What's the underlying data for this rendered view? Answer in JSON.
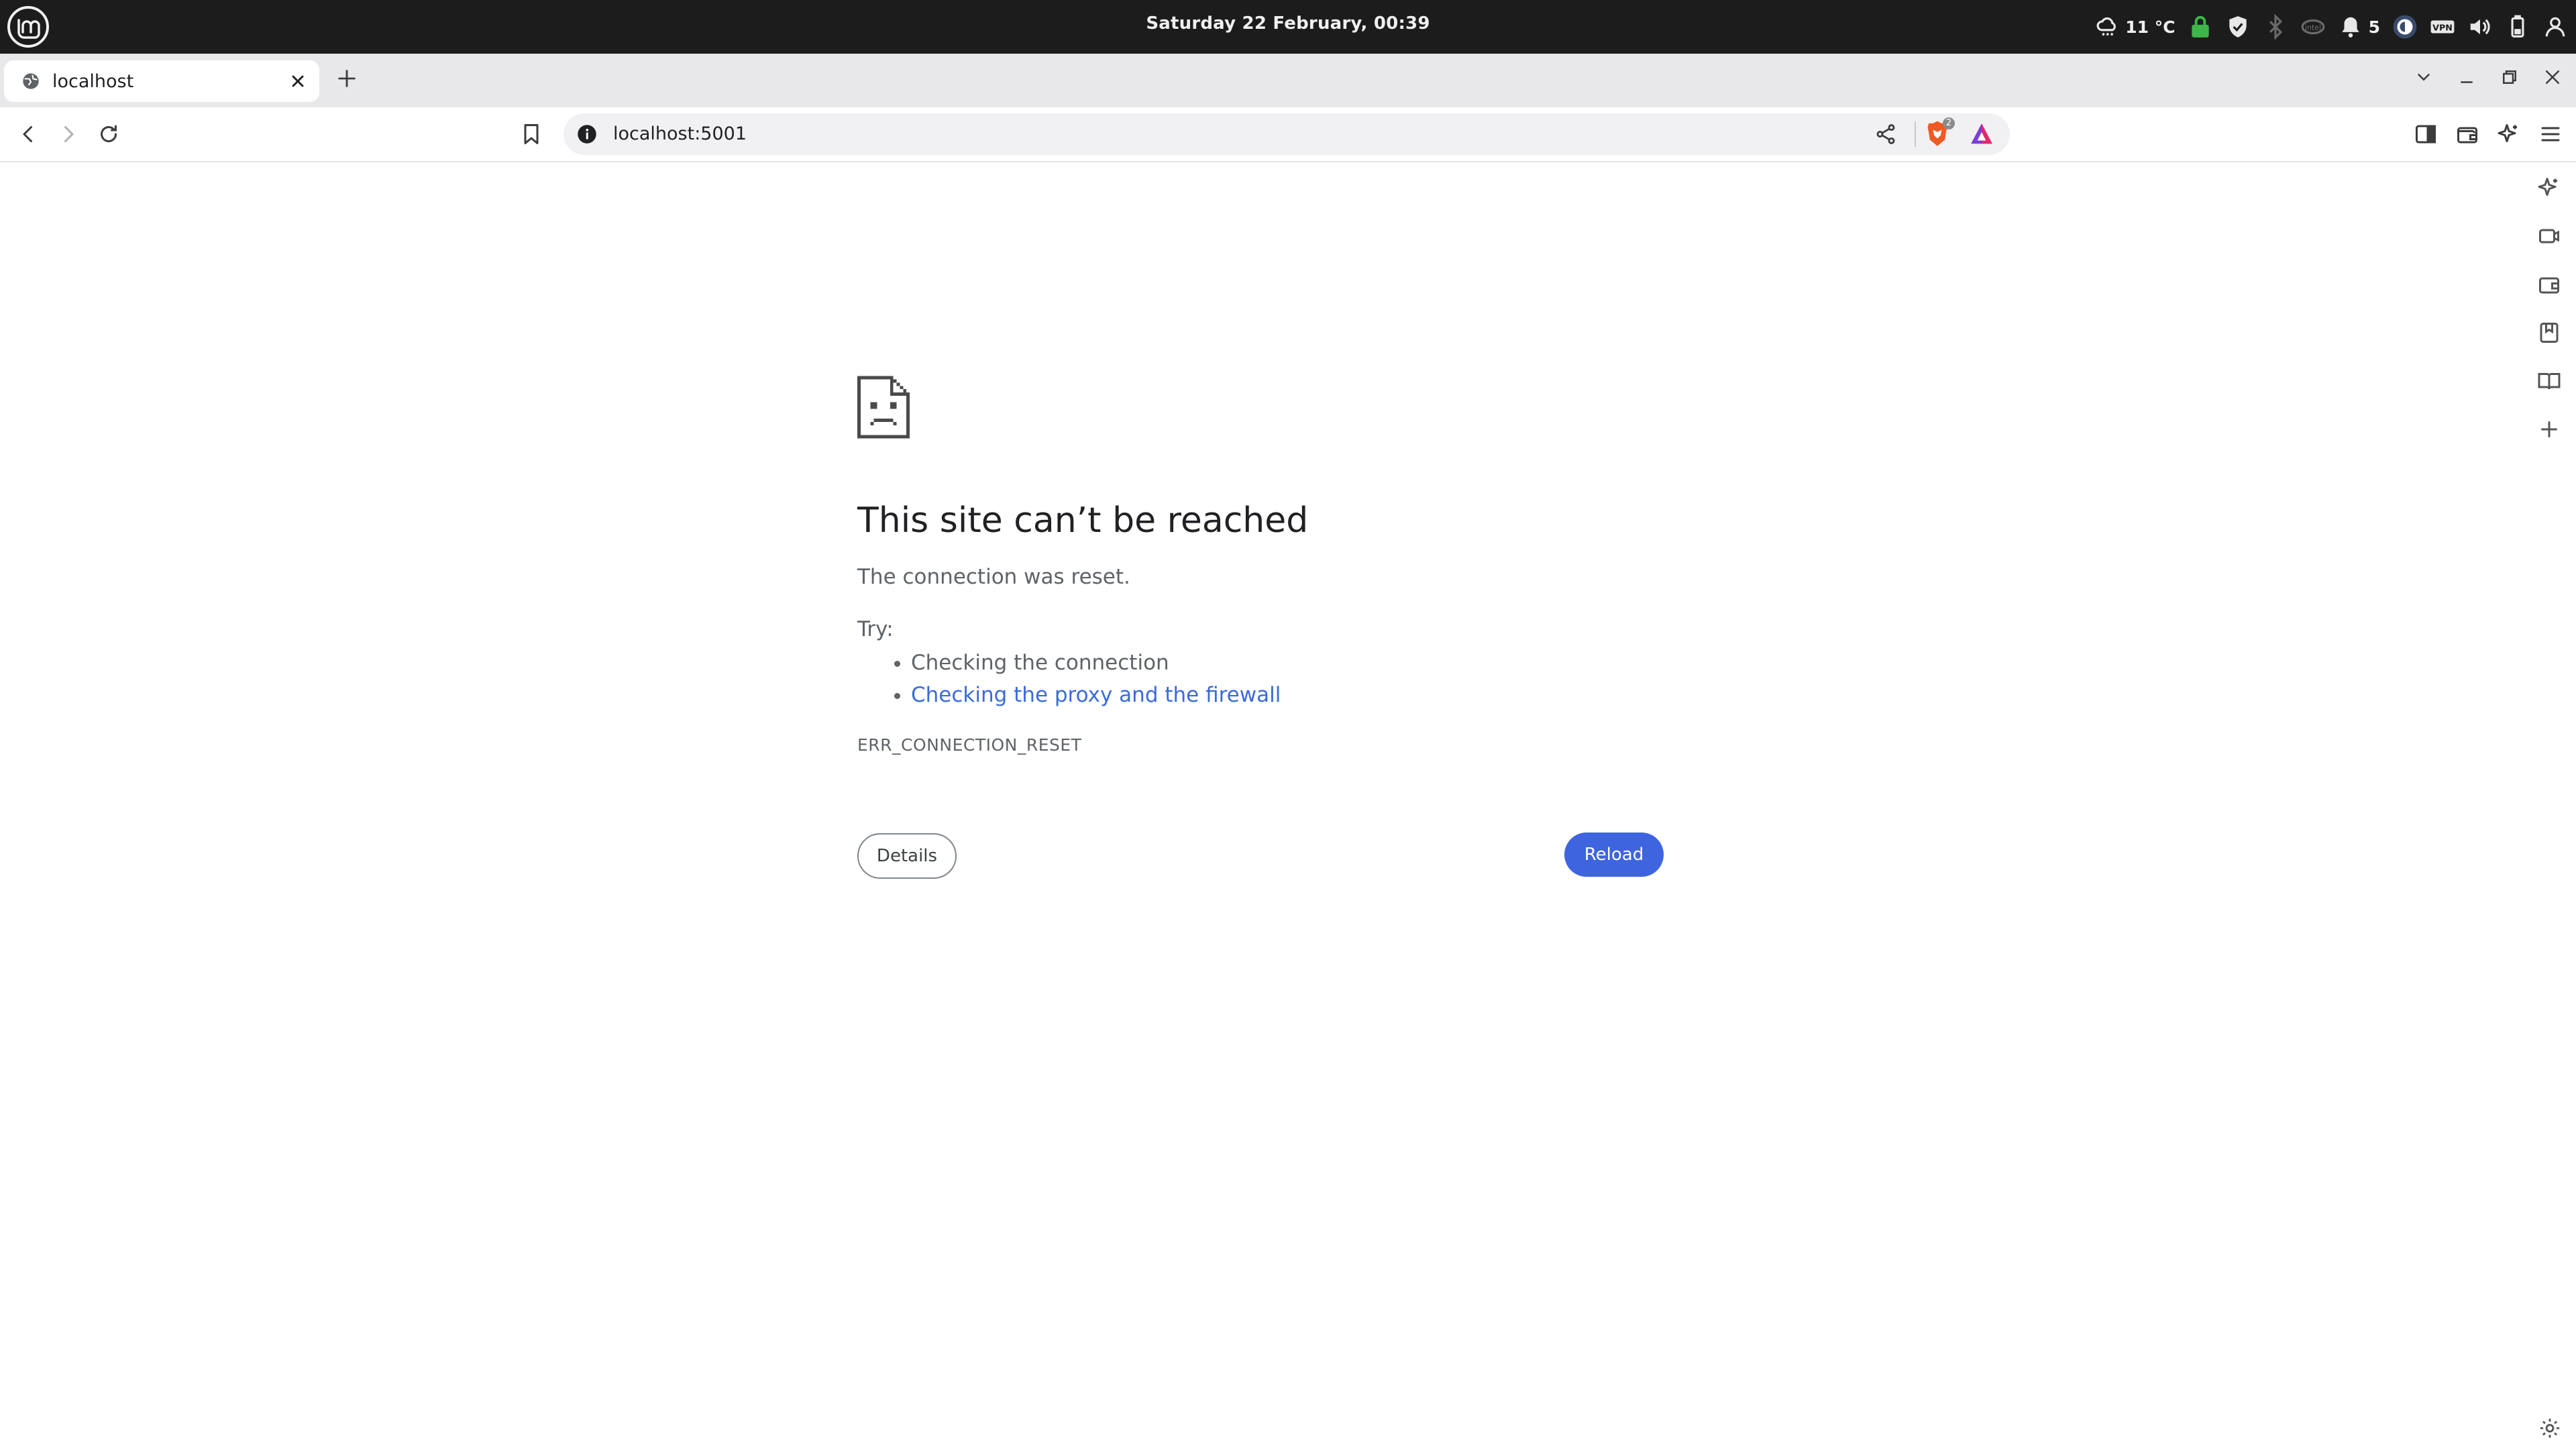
{
  "os_panel": {
    "clock": "Saturday 22 February, 00:39",
    "weather": "11 °C",
    "notification_count": "5"
  },
  "browser": {
    "tab": {
      "title": "localhost"
    },
    "address_bar": {
      "url": "localhost:5001"
    },
    "shields_count": "2"
  },
  "error_page": {
    "title": "This site can’t be reached",
    "summary": "The connection was reset.",
    "try_label": "Try:",
    "suggestions": [
      "Checking the connection",
      "Checking the proxy and the firewall"
    ],
    "error_code": "ERR_CONNECTION_RESET",
    "details_button": "Details",
    "reload_button": "Reload"
  },
  "colors": {
    "os_panel_bg": "#1c1c1c",
    "tabstrip_bg": "#e8e8ea",
    "link": "#3a6bd9",
    "reload_button_bg": "#3f64e0",
    "vpn_green": "#3fb54a",
    "shields_orange": "#f05a24"
  },
  "icons": {
    "os_menu": "linux-mint-logo-icon",
    "tray": [
      "weather-cloud-icon",
      "vpn-lock-icon",
      "shield-icon",
      "bluetooth-icon",
      "intel-gpu-icon",
      "notifications-icon",
      "privacy-indicator-icon",
      "vpn-icon",
      "volume-icon",
      "battery-icon",
      "user-icon"
    ],
    "side_panel": [
      "leo-ai-icon",
      "video-icon",
      "wallet-icon",
      "bookmarks-icon",
      "reading-list-icon",
      "add-icon"
    ]
  }
}
